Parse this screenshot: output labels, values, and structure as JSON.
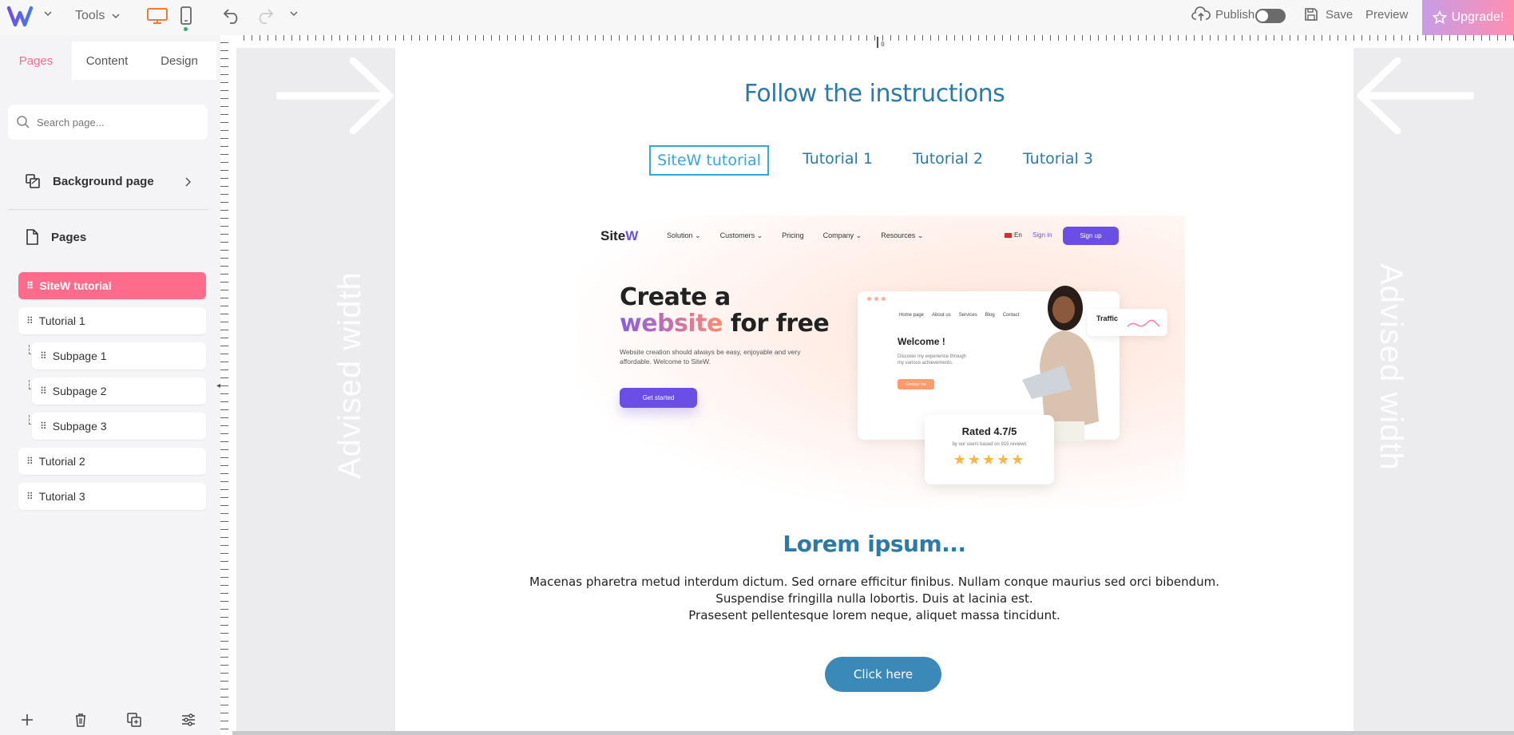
{
  "topbar": {
    "tools_label": "Tools",
    "publish_label": "Publish",
    "save_label": "Save",
    "preview_label": "Preview",
    "upgrade_label": "Upgrade!",
    "accent_color": "#f07a3a",
    "upgrade_gradient": [
      "#c79ce6",
      "#ff8fb1"
    ]
  },
  "sidebar": {
    "tabs": [
      {
        "label": "Pages",
        "active": true
      },
      {
        "label": "Content",
        "active": false
      },
      {
        "label": "Design",
        "active": false
      }
    ],
    "search_placeholder": "Search page...",
    "background_page_label": "Background page",
    "pages_header": "Pages",
    "pages": [
      {
        "label": "SiteW tutorial",
        "active": true
      },
      {
        "label": "Tutorial 1"
      },
      {
        "label": "Subpage 1"
      },
      {
        "label": "Subpage 2"
      },
      {
        "label": "Subpage 3"
      },
      {
        "label": "Tutorial 2"
      },
      {
        "label": "Tutorial 3"
      }
    ],
    "active_color": "#ff6b8a"
  },
  "canvas": {
    "ruler_zero": "0",
    "gutter_label": "Advised width",
    "page": {
      "title": "Follow the instructions",
      "tabs": [
        "SiteW tutorial",
        "Tutorial 1",
        "Tutorial 2",
        "Tutorial 3"
      ],
      "selected_tab": "SiteW tutorial",
      "hero": {
        "logo_prefix": "Site",
        "logo_suffix": "W",
        "nav": [
          "Solution ⌄",
          "Customers ⌄",
          "Pricing",
          "Company ⌄",
          "Resources ⌄"
        ],
        "lang": "En",
        "signin": "Sign in",
        "signup": "Sign up",
        "headline_line1": "Create a",
        "headline_word": "website",
        "headline_rest": " for free",
        "subtext": "Website creation should always be easy, enjoyable and very affordable. Welcome to SiteW.",
        "cta": "Get started",
        "card_nav": [
          "Home page",
          "About us",
          "Services",
          "Blog",
          "Contact"
        ],
        "welcome": "Welcome !",
        "welcome_sub": "Discover my experience through my various achievements.",
        "contact": "Contact me",
        "traffic": "Traffic",
        "rating": "Rated 4.7/5",
        "rating_sub": "by our users based on 915 reviews",
        "stars": "★★★★★"
      },
      "lorem_title": "Lorem ipsum...",
      "lorem_lines": [
        "Macenas pharetra metud interdum dictum. Sed ornare efficitur finibus. Nullam conque maurius sed orci bibendum.",
        "Suspendise fringilla nulla lobortis. Duis at lacinia est.",
        "Prasesent pellentesque lorem neque, aliquet massa tincidunt."
      ],
      "button_label": "Click here",
      "title_color": "#2b7aa8",
      "button_color": "#3a89b8"
    }
  }
}
